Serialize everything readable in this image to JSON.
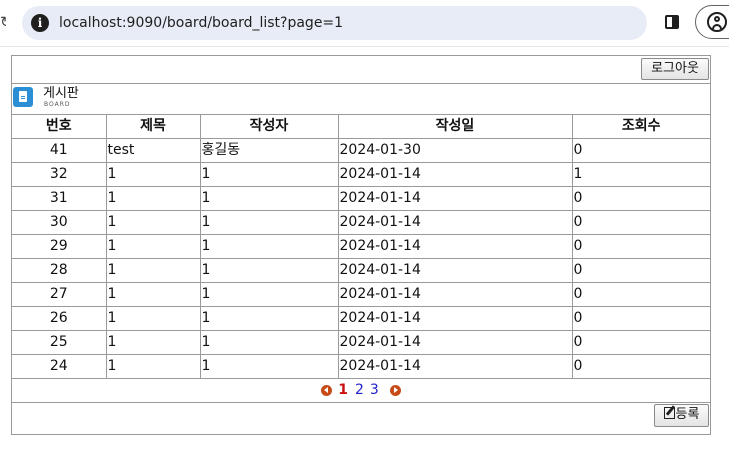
{
  "browser": {
    "url": "localhost:9090/board/board_list?page=1",
    "site_info_glyph": "i"
  },
  "header": {
    "logout_label": "로그아웃",
    "board_title": "게시판",
    "board_subtitle": "BOARD"
  },
  "table": {
    "columns": [
      "번호",
      "제목",
      "작성자",
      "작성일",
      "조회수"
    ],
    "rows": [
      [
        "41",
        "test",
        "홍길동",
        "2024-01-30",
        "0"
      ],
      [
        "32",
        "1",
        "1",
        "2024-01-14",
        "1"
      ],
      [
        "31",
        "1",
        "1",
        "2024-01-14",
        "0"
      ],
      [
        "30",
        "1",
        "1",
        "2024-01-14",
        "0"
      ],
      [
        "29",
        "1",
        "1",
        "2024-01-14",
        "0"
      ],
      [
        "28",
        "1",
        "1",
        "2024-01-14",
        "0"
      ],
      [
        "27",
        "1",
        "1",
        "2024-01-14",
        "0"
      ],
      [
        "26",
        "1",
        "1",
        "2024-01-14",
        "0"
      ],
      [
        "25",
        "1",
        "1",
        "2024-01-14",
        "0"
      ],
      [
        "24",
        "1",
        "1",
        "2024-01-14",
        "0"
      ]
    ]
  },
  "pagination": {
    "current": "1",
    "pages": [
      "2",
      "3"
    ]
  },
  "footer": {
    "write_label": "등록"
  },
  "colors": {
    "border": "#9a9a9a",
    "omnibox_bg": "#e8ecf6",
    "doc_icon": "#2c8fd6",
    "pager_arrow": "#c74b16",
    "current_page": "#cc1111",
    "page_link": "#2222cc"
  },
  "icons": [
    "reload-icon",
    "site-info-icon",
    "side-panel-icon",
    "profile-icon",
    "document-icon",
    "prev-page-icon",
    "next-page-icon",
    "edit-icon"
  ]
}
